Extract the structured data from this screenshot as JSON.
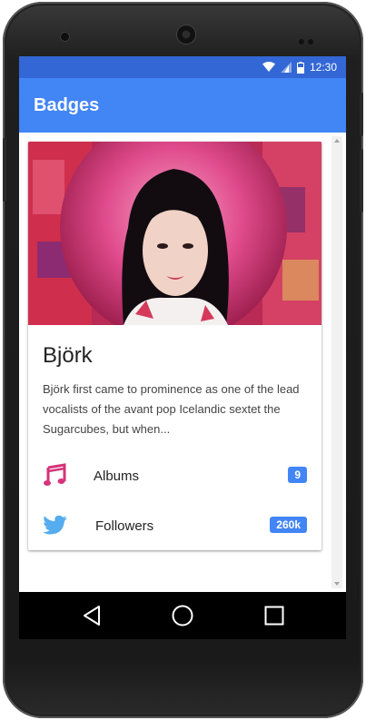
{
  "status_bar": {
    "time": "12:30",
    "icons": [
      "wifi-icon",
      "signal-icon",
      "battery-icon"
    ]
  },
  "app_bar": {
    "title": "Badges"
  },
  "card": {
    "title": "Björk",
    "description": "Björk first came to prominence as one of the lead vocalists of the avant pop Icelandic sextet the Sugarcubes, but when...",
    "image": "album-cover-photo",
    "rows": [
      {
        "icon": "music-note-icon",
        "label": "Albums",
        "badge": "9"
      },
      {
        "icon": "twitter-bird-icon",
        "label": "Followers",
        "badge": "260k"
      }
    ]
  },
  "colors": {
    "status_bar": "#3367d6",
    "app_bar": "#4285f4",
    "badge": "#4285f4",
    "music_icon": "#d6337a",
    "twitter_icon": "#55acee"
  },
  "nav_bar": {
    "icons": [
      "back-icon",
      "home-icon",
      "recents-icon"
    ]
  }
}
